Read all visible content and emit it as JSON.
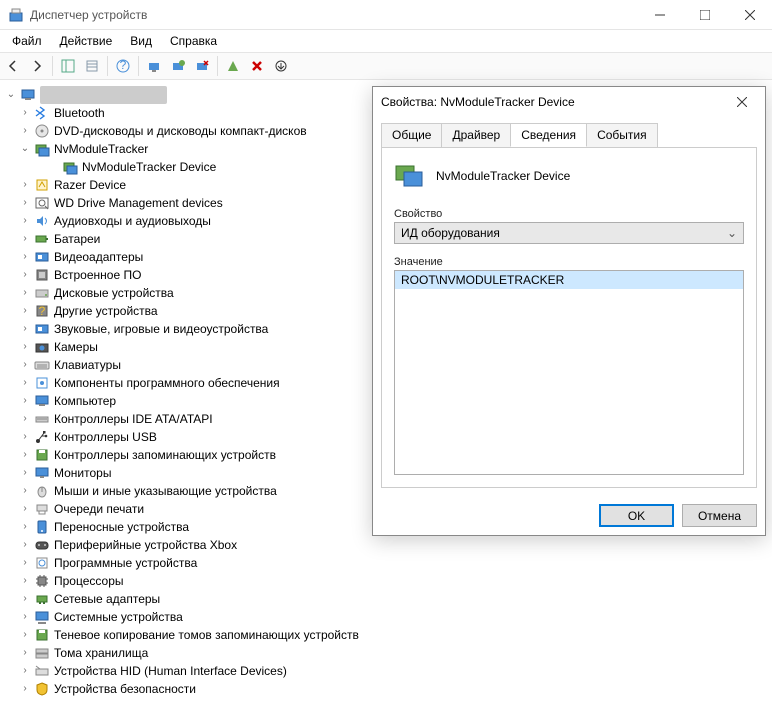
{
  "window": {
    "title": "Диспетчер устройств"
  },
  "menu": {
    "file": "Файл",
    "action": "Действие",
    "view": "Вид",
    "help": "Справка"
  },
  "tree": {
    "root": "",
    "items": [
      {
        "label": "Bluetooth",
        "expandable": true
      },
      {
        "label": "DVD-дисководы и дисководы компакт-дисков",
        "expandable": true
      },
      {
        "label": "NvModuleTracker",
        "expandable": true,
        "expanded": true,
        "children": [
          {
            "label": "NvModuleTracker Device"
          }
        ]
      },
      {
        "label": "Razer Device",
        "expandable": true
      },
      {
        "label": "WD Drive Management devices",
        "expandable": true
      },
      {
        "label": "Аудиовходы и аудиовыходы",
        "expandable": true
      },
      {
        "label": "Батареи",
        "expandable": true
      },
      {
        "label": "Видеоадаптеры",
        "expandable": true
      },
      {
        "label": "Встроенное ПО",
        "expandable": true
      },
      {
        "label": "Дисковые устройства",
        "expandable": true
      },
      {
        "label": "Другие устройства",
        "expandable": true
      },
      {
        "label": "Звуковые, игровые и видеоустройства",
        "expandable": true
      },
      {
        "label": "Камеры",
        "expandable": true
      },
      {
        "label": "Клавиатуры",
        "expandable": true
      },
      {
        "label": "Компоненты программного обеспечения",
        "expandable": true
      },
      {
        "label": "Компьютер",
        "expandable": true
      },
      {
        "label": "Контроллеры IDE ATA/ATAPI",
        "expandable": true
      },
      {
        "label": "Контроллеры USB",
        "expandable": true
      },
      {
        "label": "Контроллеры запоминающих устройств",
        "expandable": true
      },
      {
        "label": "Мониторы",
        "expandable": true
      },
      {
        "label": "Мыши и иные указывающие устройства",
        "expandable": true
      },
      {
        "label": "Очереди печати",
        "expandable": true
      },
      {
        "label": "Переносные устройства",
        "expandable": true
      },
      {
        "label": "Периферийные устройства Xbox",
        "expandable": true
      },
      {
        "label": "Программные устройства",
        "expandable": true
      },
      {
        "label": "Процессоры",
        "expandable": true
      },
      {
        "label": "Сетевые адаптеры",
        "expandable": true
      },
      {
        "label": "Системные устройства",
        "expandable": true
      },
      {
        "label": "Теневое копирование томов запоминающих устройств",
        "expandable": true
      },
      {
        "label": "Тома хранилища",
        "expandable": true
      },
      {
        "label": "Устройства HID (Human Interface Devices)",
        "expandable": true
      },
      {
        "label": "Устройства безопасности",
        "expandable": true
      }
    ]
  },
  "dialog": {
    "title": "Свойства: NvModuleTracker Device",
    "tabs": {
      "general": "Общие",
      "driver": "Драйвер",
      "details": "Сведения",
      "events": "События"
    },
    "device_name": "NvModuleTracker Device",
    "property_label": "Свойство",
    "property_value": "ИД оборудования",
    "value_label": "Значение",
    "value_item": "ROOT\\NVMODULETRACKER",
    "ok": "OK",
    "cancel": "Отмена"
  },
  "icons": {
    "colors": {
      "blue": "#3b78c8",
      "green": "#6aa84f",
      "red": "#cc0000",
      "yellow": "#f1c232",
      "gray": "#888",
      "dblue": "#1f4e79",
      "teal": "#2a9d8f"
    }
  }
}
